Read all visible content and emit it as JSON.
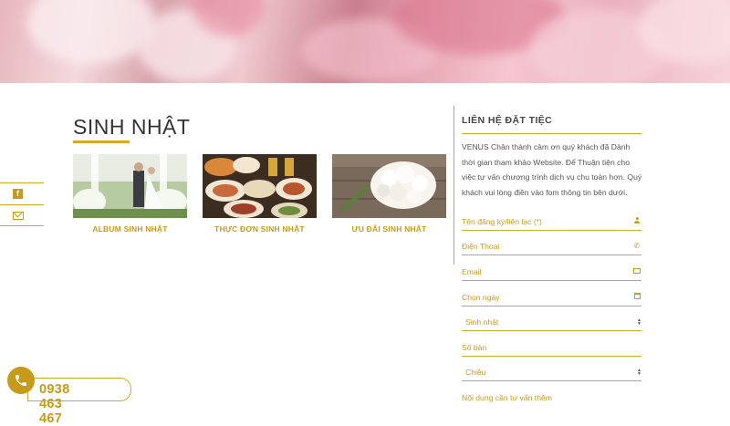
{
  "section": {
    "title": "SINH NHẬT",
    "albums": [
      {
        "caption": "ALBUM SINH NHẬT"
      },
      {
        "caption": "THỰC ĐƠN SINH NHẬT"
      },
      {
        "caption": "ƯU ĐÃI SINH NHẬT"
      }
    ]
  },
  "form": {
    "title": "LIÊN HỆ ĐẶT TIỆC",
    "description": "VENUS Chân thành cảm ơn quý khách đã Dành thời gian tham khảo Website. Để Thuận tiện cho việc tư vấn chương trình dịch vụ chu toàn hơn. Quý khách vui lòng điền vào fom thông tin bên dưới.",
    "fields": {
      "name_placeholder": "Tên đăng ký/liên lạc (*)",
      "phone_placeholder": "Điện Thoại",
      "email_placeholder": "Email",
      "date_placeholder": "Chọn ngày",
      "event_select_value": "Sinh nhật",
      "tables_placeholder": "Số bàn",
      "session_select_value": "Chiều",
      "content_placeholder": "Nội dung cần tư vấn thêm"
    }
  },
  "hotline": {
    "number": "0938 463 467"
  },
  "colors": {
    "accent": "#c89a1a",
    "line": "#d5a928",
    "text": "#555555"
  },
  "icons": [
    "facebook-icon",
    "mail-icon",
    "user-icon",
    "phone-icon",
    "envelope-icon",
    "calendar-icon",
    "select-arrows-icon"
  ]
}
